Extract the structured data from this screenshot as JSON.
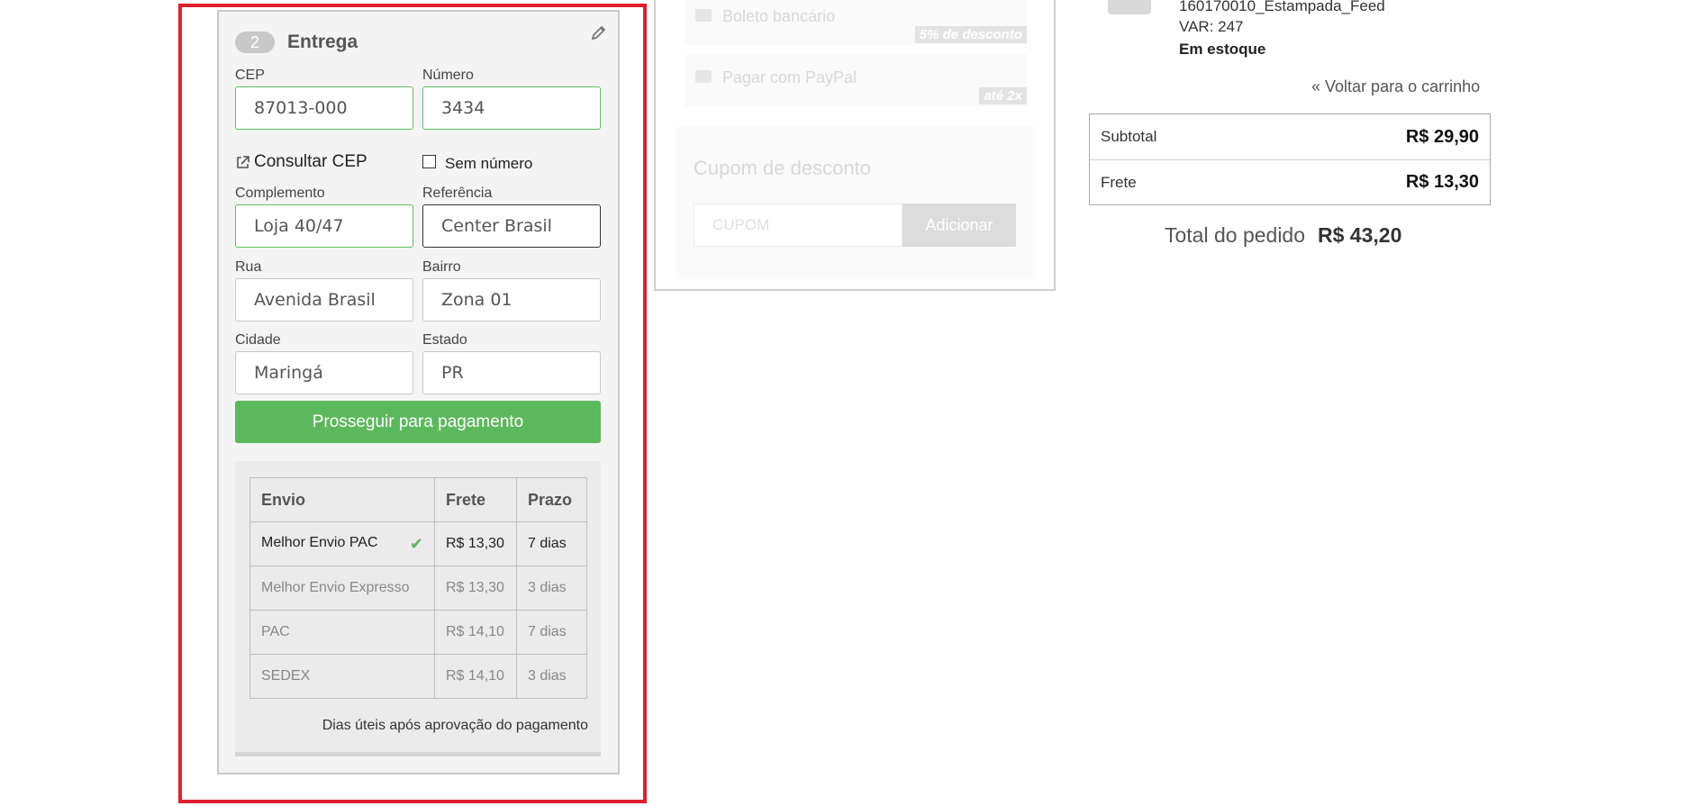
{
  "delivery": {
    "step_number": "2",
    "title": "Entrega",
    "fields": {
      "cep": {
        "label": "CEP",
        "value": "87013-000"
      },
      "numero": {
        "label": "Número",
        "value": "3434"
      },
      "complemento": {
        "label": "Complemento",
        "value": "Loja 40/47"
      },
      "referencia": {
        "label": "Referência",
        "value": "Center Brasil"
      },
      "rua": {
        "label": "Rua",
        "value": "Avenida Brasil"
      },
      "bairro": {
        "label": "Bairro",
        "value": "Zona 01"
      },
      "cidade": {
        "label": "Cidade",
        "value": "Maringá"
      },
      "estado": {
        "label": "Estado",
        "value": "PR"
      }
    },
    "consult_cep_label": "Consultar CEP",
    "no_number_label": "Sem número",
    "no_number_checked": false,
    "continue_button": "Prosseguir para pagamento",
    "shipping": {
      "headers": [
        "Envio",
        "Frete",
        "Prazo"
      ],
      "rows": [
        {
          "name": "Melhor Envio PAC",
          "price": "R$ 13,30",
          "time": "7 dias",
          "selected": true
        },
        {
          "name": "Melhor Envio Expresso",
          "price": "R$ 13,30",
          "time": "3 dias",
          "selected": false
        },
        {
          "name": "PAC",
          "price": "R$ 14,10",
          "time": "7 dias",
          "selected": false
        },
        {
          "name": "SEDEX",
          "price": "R$ 14,10",
          "time": "3 dias",
          "selected": false
        }
      ],
      "note": "Dias úteis após aprovação do pagamento"
    }
  },
  "payment": {
    "options": [
      {
        "label": "Boleto bancário",
        "tag": "5% de desconto"
      },
      {
        "label": "Pagar com PayPal",
        "tag": "até 2x"
      }
    ],
    "coupon": {
      "title": "Cupom de desconto",
      "placeholder": "CUPOM",
      "button": "Adicionar"
    }
  },
  "summary": {
    "product": {
      "name": "160170010_Estampada_Feed",
      "variant": "VAR: 247",
      "stock": "Em estoque"
    },
    "back_link": "Voltar para o carrinho",
    "subtotal_label": "Subtotal",
    "subtotal_value": "R$ 29,90",
    "shipping_label": "Frete",
    "shipping_value": "R$ 13,30",
    "total_label": "Total do pedido",
    "total_value": "R$ 43,20"
  },
  "colors": {
    "accent_green": "#5cb85c",
    "highlight_red": "#e0202b"
  },
  "icons": [
    "edit-icon",
    "external-link-icon",
    "checkmark-icon",
    "double-chevron-left-icon",
    "barcode-icon",
    "paypal-icon"
  ]
}
